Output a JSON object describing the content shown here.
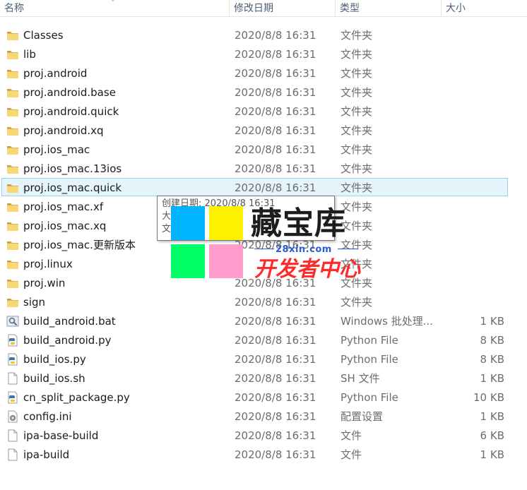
{
  "header": {
    "name": "名称",
    "date": "修改日期",
    "type": "类型",
    "size": "大小"
  },
  "files": [
    {
      "name": "Classes",
      "date": "2020/8/8 16:31",
      "type": "文件夹",
      "size": "",
      "icon": "folder-icon"
    },
    {
      "name": "lib",
      "date": "2020/8/8 16:31",
      "type": "文件夹",
      "size": "",
      "icon": "folder-icon"
    },
    {
      "name": "proj.android",
      "date": "2020/8/8 16:31",
      "type": "文件夹",
      "size": "",
      "icon": "folder-icon"
    },
    {
      "name": "proj.android.base",
      "date": "2020/8/8 16:31",
      "type": "文件夹",
      "size": "",
      "icon": "folder-icon"
    },
    {
      "name": "proj.android.quick",
      "date": "2020/8/8 16:31",
      "type": "文件夹",
      "size": "",
      "icon": "folder-icon"
    },
    {
      "name": "proj.android.xq",
      "date": "2020/8/8 16:31",
      "type": "文件夹",
      "size": "",
      "icon": "folder-icon"
    },
    {
      "name": "proj.ios_mac",
      "date": "2020/8/8 16:31",
      "type": "文件夹",
      "size": "",
      "icon": "folder-icon"
    },
    {
      "name": "proj.ios_mac.13ios",
      "date": "2020/8/8 16:31",
      "type": "文件夹",
      "size": "",
      "icon": "folder-icon"
    },
    {
      "name": "proj.ios_mac.quick",
      "date": "2020/8/8 16:31",
      "type": "文件夹",
      "size": "",
      "icon": "folder-icon",
      "selected": true
    },
    {
      "name": "proj.ios_mac.xf",
      "date": "",
      "type": "文件夹",
      "size": "",
      "icon": "folder-icon"
    },
    {
      "name": "proj.ios_mac.xq",
      "date": "",
      "type": "文件夹",
      "size": "",
      "icon": "folder-icon"
    },
    {
      "name": "proj.ios_mac.更新版本",
      "date": "2020/8/8 16:31",
      "type": "文件夹",
      "size": "",
      "icon": "folder-icon"
    },
    {
      "name": "proj.linux",
      "date": "",
      "type": "文件夹",
      "size": "",
      "icon": "folder-icon"
    },
    {
      "name": "proj.win",
      "date": "2020/8/8 16:31",
      "type": "文件夹",
      "size": "",
      "icon": "folder-icon"
    },
    {
      "name": "sign",
      "date": "2020/8/8 16:31",
      "type": "文件夹",
      "size": "",
      "icon": "folder-icon"
    },
    {
      "name": "build_android.bat",
      "date": "2020/8/8 16:31",
      "type": "Windows 批处理...",
      "size": "1 KB",
      "icon": "batch-file-icon"
    },
    {
      "name": "build_android.py",
      "date": "2020/8/8 16:31",
      "type": "Python File",
      "size": "8 KB",
      "icon": "python-file-icon"
    },
    {
      "name": "build_ios.py",
      "date": "2020/8/8 16:31",
      "type": "Python File",
      "size": "8 KB",
      "icon": "python-file-icon"
    },
    {
      "name": "build_ios.sh",
      "date": "2020/8/8 16:31",
      "type": "SH 文件",
      "size": "1 KB",
      "icon": "blank-file-icon"
    },
    {
      "name": "cn_split_package.py",
      "date": "2020/8/8 16:31",
      "type": "Python File",
      "size": "10 KB",
      "icon": "python-file-icon"
    },
    {
      "name": "config.ini",
      "date": "2020/8/8 16:31",
      "type": "配置设置",
      "size": "1 KB",
      "icon": "config-file-icon"
    },
    {
      "name": "ipa-base-build",
      "date": "2020/8/8 16:31",
      "type": "文件",
      "size": "6 KB",
      "icon": "blank-file-icon"
    },
    {
      "name": "ipa-build",
      "date": "2020/8/8 16:31",
      "type": "文件",
      "size": "1 KB",
      "icon": "blank-file-icon"
    }
  ],
  "tooltip": {
    "line1": "创建日期: 2020/8/8 16:31",
    "line2": "大",
    "line3": "文"
  },
  "watermark": {
    "title": "藏宝库",
    "url": "28xin.com",
    "subtitle": "开发者中心",
    "colors": [
      "#00b4ff",
      "#fff200",
      "#00ff66",
      "#ff9ccc"
    ]
  }
}
